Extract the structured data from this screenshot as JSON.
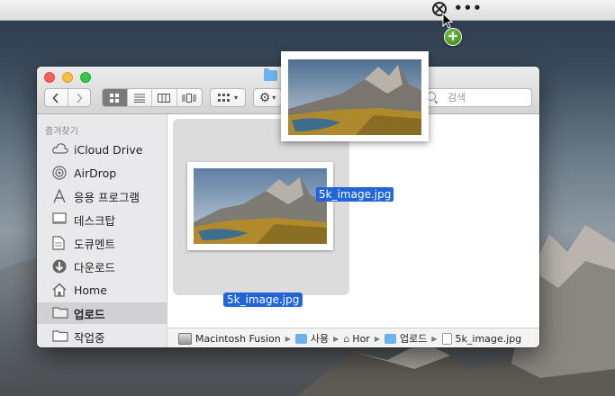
{
  "menubar": {
    "status_icon": "no-entry-circle-icon",
    "more_icon": "ellipsis-icon"
  },
  "drag": {
    "filename": "5k_image.jpg",
    "badge": "+"
  },
  "window": {
    "title_icon": "folder-icon",
    "toolbar": {
      "back_icon": "chevron-left-icon",
      "forward_icon": "chevron-right-icon",
      "views": [
        "icon-view-icon",
        "list-view-icon",
        "column-view-icon",
        "coverflow-view-icon"
      ],
      "arrange_icon": "arrange-grid-icon",
      "action_icon": "gear-icon",
      "search_placeholder": "검색"
    },
    "sidebar": {
      "section_title": "즐겨찾기",
      "items": [
        {
          "label": "iCloud Drive",
          "icon": "cloud-icon"
        },
        {
          "label": "AirDrop",
          "icon": "airdrop-icon"
        },
        {
          "label": "응용 프로그램",
          "icon": "applications-icon"
        },
        {
          "label": "데스크탑",
          "icon": "desktop-icon"
        },
        {
          "label": "도큐멘트",
          "icon": "document-icon"
        },
        {
          "label": "다운로드",
          "icon": "download-icon"
        },
        {
          "label": "Home",
          "icon": "home-icon"
        },
        {
          "label": "업로드",
          "icon": "folder-icon"
        },
        {
          "label": "작업중",
          "icon": "folder-icon"
        }
      ],
      "selected_index": 7
    },
    "content": {
      "file": {
        "name": "5k_image.jpg",
        "icon": "image-thumbnail"
      }
    },
    "pathbar": [
      {
        "label": "Macintosh Fusion",
        "icon": "hard-drive-icon"
      },
      {
        "label": "사용",
        "icon": "users-folder-icon"
      },
      {
        "label": "Hor",
        "icon": "home-icon"
      },
      {
        "label": "업로드",
        "icon": "folder-icon"
      },
      {
        "label": "5k_image.jpg",
        "icon": "file-icon"
      }
    ]
  },
  "colors": {
    "selection": "#2165d9",
    "sidebar_bg": "#e9e9ec",
    "badge_green": "#3a9a1c"
  }
}
